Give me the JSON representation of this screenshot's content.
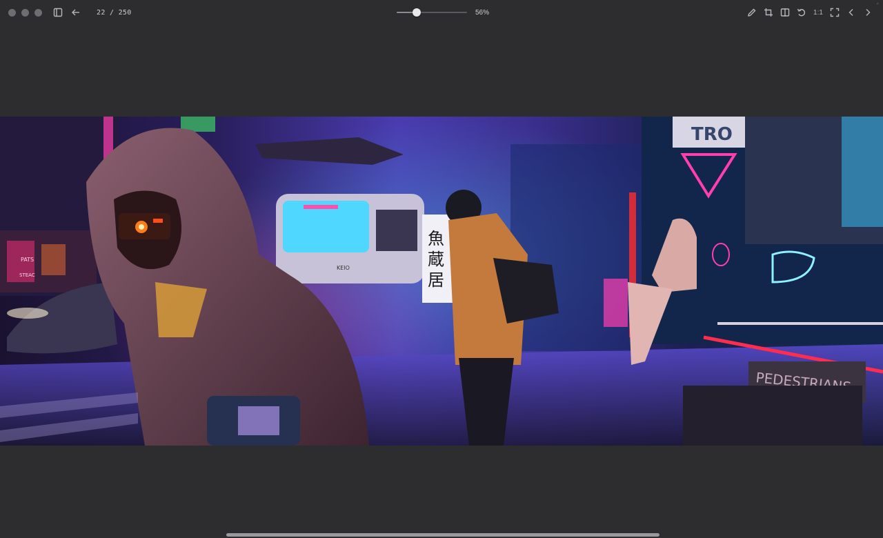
{
  "toolbar": {
    "counter": "22 / 250",
    "zoom_label": "56%",
    "zoom_percent": 56,
    "actual_size_label": "1:1",
    "icons": {
      "sidebar": "sidebar-icon",
      "back": "arrow-left-icon",
      "edit": "pencil-icon",
      "crop": "crop-icon",
      "compare": "split-view-icon",
      "rotate": "rotate-icon",
      "fullscreen": "fullscreen-icon",
      "prev": "chevron-left-icon",
      "next": "chevron-right-icon"
    }
  },
  "image": {
    "signs": {
      "kanji_1": "魚",
      "kanji_2": "蔵",
      "kanji_3": "居",
      "sign_top": "TRO",
      "pedestrians": "PEDESTRIANS",
      "train": "KEIO",
      "left_sign": "PATS",
      "left_sign_2": "STEAC"
    }
  },
  "colors": {
    "window_bg": "#2d2d2f",
    "neon_pink": "#ff2d7a",
    "neon_cyan": "#39d8ff",
    "neon_purple": "#7b4dff"
  }
}
